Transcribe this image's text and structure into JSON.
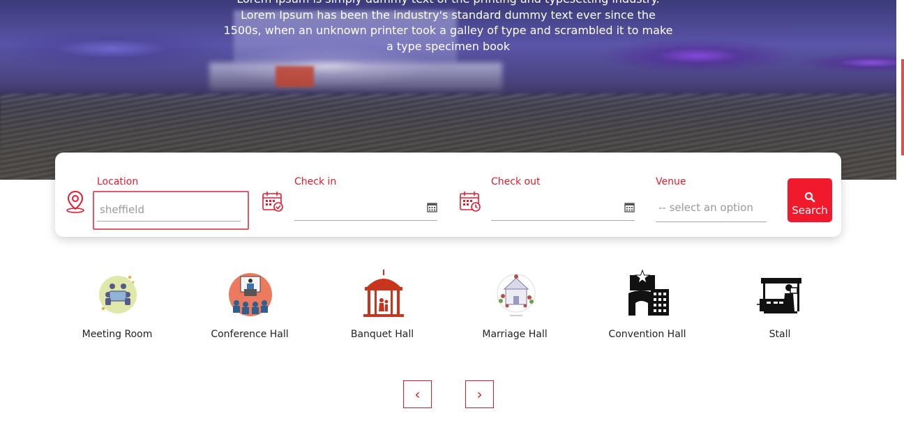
{
  "hero": {
    "description": "Lorem Ipsum is simply dummy text of the printing and typesetting industry. Lorem Ipsum has been the industry's standard dummy text ever since the 1500s, when an unknown printer took a galley of type and scrambled it to make a type specimen book"
  },
  "search": {
    "location_label": "Location",
    "location_placeholder": "sheffield",
    "checkin_label": "Check in",
    "checkout_label": "Check out",
    "venue_label": "Venue",
    "venue_placeholder": "-- select an option",
    "button_label": "Search",
    "accent_color": "#f01a2c"
  },
  "categories": [
    {
      "label": "Meeting Room",
      "icon": "meeting-room-icon"
    },
    {
      "label": "Conference Hall",
      "icon": "conference-hall-icon"
    },
    {
      "label": "Banquet Hall",
      "icon": "banquet-hall-icon"
    },
    {
      "label": "Marriage Hall",
      "icon": "marriage-hall-icon"
    },
    {
      "label": "Convention Hall",
      "icon": "convention-hall-icon"
    },
    {
      "label": "Stall",
      "icon": "stall-icon"
    }
  ],
  "pager": {
    "prev_label": "‹",
    "next_label": "›"
  }
}
